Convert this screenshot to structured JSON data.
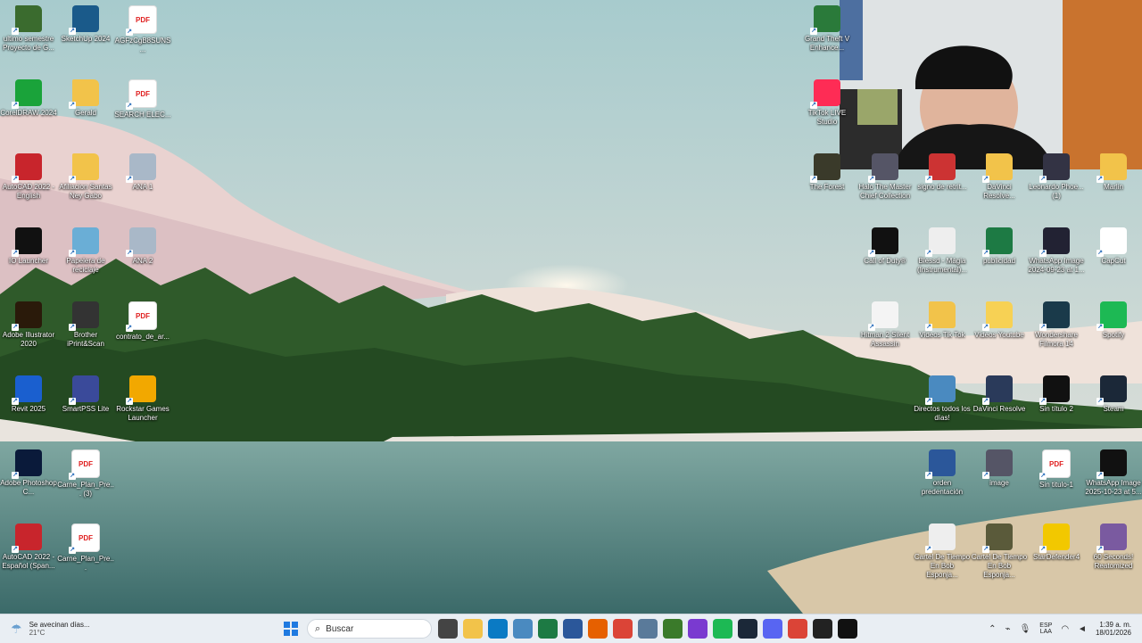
{
  "desktop": {
    "icons": [
      {
        "label": "ultimo semestre Proyecto de G...",
        "icon": "folder-icon",
        "color": "#3a6b2e"
      },
      {
        "label": "SketchUp 2024",
        "icon": "sketchup-icon",
        "color": "#1a5a8a"
      },
      {
        "label": "AGFzCgB8SUNS...",
        "icon": "pdf-icon",
        "color": "#e02020"
      },
      {
        "label": "CorelDRAW 2024",
        "icon": "coreldraw-icon",
        "color": "#1aa33a"
      },
      {
        "label": "Gerald",
        "icon": "folder-icon",
        "color": "#f2c34a"
      },
      {
        "label": "SEARCH ELEC...",
        "icon": "pdf-icon",
        "color": "#e02020"
      },
      {
        "label": "AutoCAD 2022 - English",
        "icon": "autocad-icon",
        "color": "#c8252c"
      },
      {
        "label": "Afiliacion Santas Ney Gabo",
        "icon": "folder-icon",
        "color": "#f2c34a"
      },
      {
        "label": "ANA 1",
        "icon": "image-icon",
        "color": "#a9b8c8"
      },
      {
        "label": "IO Launcher",
        "icon": "io-launcher-icon",
        "color": "#111"
      },
      {
        "label": "Papelera de reciclaje",
        "icon": "recycle-bin-icon",
        "color": "#6aaed6"
      },
      {
        "label": "ANA 2",
        "icon": "image-icon",
        "color": "#a9b8c8"
      },
      {
        "label": "Adobe Illustrator 2020",
        "icon": "illustrator-icon",
        "color": "#2a1a0a"
      },
      {
        "label": "Brother iPrint&Scan",
        "icon": "brother-icon",
        "color": "#333"
      },
      {
        "label": "contrato_de_ar...",
        "icon": "pdf-icon",
        "color": "#e02020"
      },
      {
        "label": "Revit 2025",
        "icon": "revit-icon",
        "color": "#1a5fcf"
      },
      {
        "label": "SmartPSS Lite",
        "icon": "smartpss-icon",
        "color": "#3a4a9a"
      },
      {
        "label": "Rockstar Games Launcher",
        "icon": "rockstar-icon",
        "color": "#f2a800"
      },
      {
        "label": "Adobe Photoshop C...",
        "icon": "photoshop-icon",
        "color": "#0a1a3a"
      },
      {
        "label": "Carne_Plan_Pre... (3)",
        "icon": "pdf-icon",
        "color": "#e02020"
      },
      {
        "label": "AutoCAD 2022 - Español (Span...",
        "icon": "autocad-icon",
        "color": "#c8252c"
      },
      {
        "label": "Carne_Plan_Pre...",
        "icon": "pdf-icon",
        "color": "#e02020"
      },
      {
        "label": "Grand Theft V Enhance...",
        "icon": "gta-icon",
        "color": "#2a7a3a"
      },
      {
        "label": "TikTok LIVE Studio",
        "icon": "tiktok-icon",
        "color": "#fe2c55"
      },
      {
        "label": "The Forest",
        "icon": "game-icon",
        "color": "#3a3a2a"
      },
      {
        "label": "Halo The Master Chief Collection",
        "icon": "game-icon",
        "color": "#556"
      },
      {
        "label": "signo de retrit...",
        "icon": "image-icon",
        "color": "#c33"
      },
      {
        "label": "DaVinci Resolve...",
        "icon": "folder-icon",
        "color": "#f2c34a"
      },
      {
        "label": "Leonardo Phoe... (1)",
        "icon": "image-icon",
        "color": "#334"
      },
      {
        "label": "Marlin",
        "icon": "folder-icon",
        "color": "#f2c34a"
      },
      {
        "label": "Call of Duty®",
        "icon": "callofduty-icon",
        "color": "#111"
      },
      {
        "label": "Blessd - Mágia (Instrumental)...",
        "icon": "media-icon",
        "color": "#eee"
      },
      {
        "label": "publicidad",
        "icon": "excel-icon",
        "color": "#1d7a44"
      },
      {
        "label": "WhatsApp Image 2024-09-23 at 1...",
        "icon": "image-icon",
        "color": "#223"
      },
      {
        "label": "CapCut",
        "icon": "capcut-icon",
        "color": "#fff"
      },
      {
        "label": "Hitman 2 Silent Assassin",
        "icon": "file-icon",
        "color": "#f4f4f4"
      },
      {
        "label": "Videos Tik Tok",
        "icon": "folder-icon",
        "color": "#f2c34a"
      },
      {
        "label": "Videos Youtube",
        "icon": "folder-icon",
        "color": "#f7d154"
      },
      {
        "label": "Wondershare Filmora 14",
        "icon": "filmora-icon",
        "color": "#1a3a4a"
      },
      {
        "label": "Spotify",
        "icon": "spotify-icon",
        "color": "#1db954"
      },
      {
        "label": "Directos todos los días!",
        "icon": "image-icon",
        "color": "#4a8ac0"
      },
      {
        "label": "DaVinci Resolve",
        "icon": "davinci-icon",
        "color": "#2a3a5a"
      },
      {
        "label": "Sin título 2",
        "icon": "image-icon",
        "color": "#111"
      },
      {
        "label": "Steam",
        "icon": "steam-icon",
        "color": "#1b2838"
      },
      {
        "label": "orden predentación",
        "icon": "word-icon",
        "color": "#2b579a"
      },
      {
        "label": "image",
        "icon": "image-icon",
        "color": "#556"
      },
      {
        "label": "Sin titulo-1",
        "icon": "pdf-icon",
        "color": "#e02020"
      },
      {
        "label": "WhatsApp Image 2025-10-23 at 5...",
        "icon": "image-icon",
        "color": "#111"
      },
      {
        "label": "Cartel De Tiempo En Bob Esponja...",
        "icon": "media-icon",
        "color": "#eee"
      },
      {
        "label": "Cartel De Tiempo En Bob Esponja...",
        "icon": "video-icon",
        "color": "#5a5a3a"
      },
      {
        "label": "StarDefender4",
        "icon": "game-icon",
        "color": "#f2c800"
      },
      {
        "label": "60 Seconds! Reatomized",
        "icon": "game-icon",
        "color": "#7a5aa0"
      }
    ]
  },
  "taskbar": {
    "weather_text": "Se avecinan días...",
    "weather_temp": "21°C",
    "search_placeholder": "Buscar",
    "language_top": "ESP",
    "language_bottom": "LAA",
    "time": "1:39 a. m.",
    "date": "18/01/2026",
    "apps": [
      {
        "name": "task-view-icon",
        "color": "#444"
      },
      {
        "name": "file-explorer-icon",
        "color": "#f2c34a"
      },
      {
        "name": "edge-icon",
        "color": "#0a7ac4"
      },
      {
        "name": "photos-icon",
        "color": "#4a8ac0"
      },
      {
        "name": "excel-icon",
        "color": "#1d7a44"
      },
      {
        "name": "word-icon",
        "color": "#2b579a"
      },
      {
        "name": "firefox-icon",
        "color": "#e66000"
      },
      {
        "name": "chrome-icon",
        "color": "#db4437"
      },
      {
        "name": "settings-icon",
        "color": "#5a7a9a"
      },
      {
        "name": "minecraft-icon",
        "color": "#3a7a2a"
      },
      {
        "name": "obs-icon",
        "color": "#7a3ad0"
      },
      {
        "name": "spotify-icon",
        "color": "#1db954"
      },
      {
        "name": "steam-icon",
        "color": "#1b2838"
      },
      {
        "name": "discord-icon",
        "color": "#5865f2"
      },
      {
        "name": "chrome-profile-icon",
        "color": "#db4437"
      },
      {
        "name": "github-icon",
        "color": "#222"
      },
      {
        "name": "callofduty-icon",
        "color": "#111"
      }
    ]
  }
}
